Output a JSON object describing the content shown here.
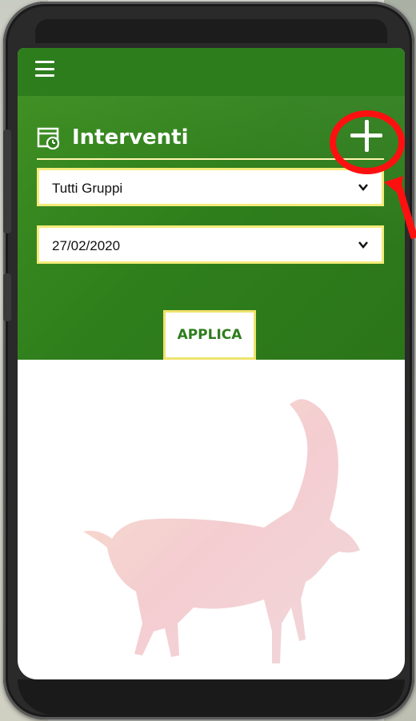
{
  "app": {
    "menu_icon": "hamburger-menu-icon"
  },
  "header": {
    "title": "Interventi",
    "title_icon": "calendar-clock-icon",
    "add_icon": "plus-icon"
  },
  "filters": {
    "group_select": {
      "value": "Tutti Gruppi",
      "icon": "chevron-down-icon"
    },
    "date_select": {
      "value": "27/02/2020",
      "icon": "chevron-down-icon"
    },
    "apply_label": "APPLICA"
  },
  "content": {
    "illustration": "ibex-illustration"
  },
  "colors": {
    "primary_green": "#2e7d1d",
    "accent_yellow": "#f3ec7a",
    "annotation_red": "#ff1010"
  }
}
